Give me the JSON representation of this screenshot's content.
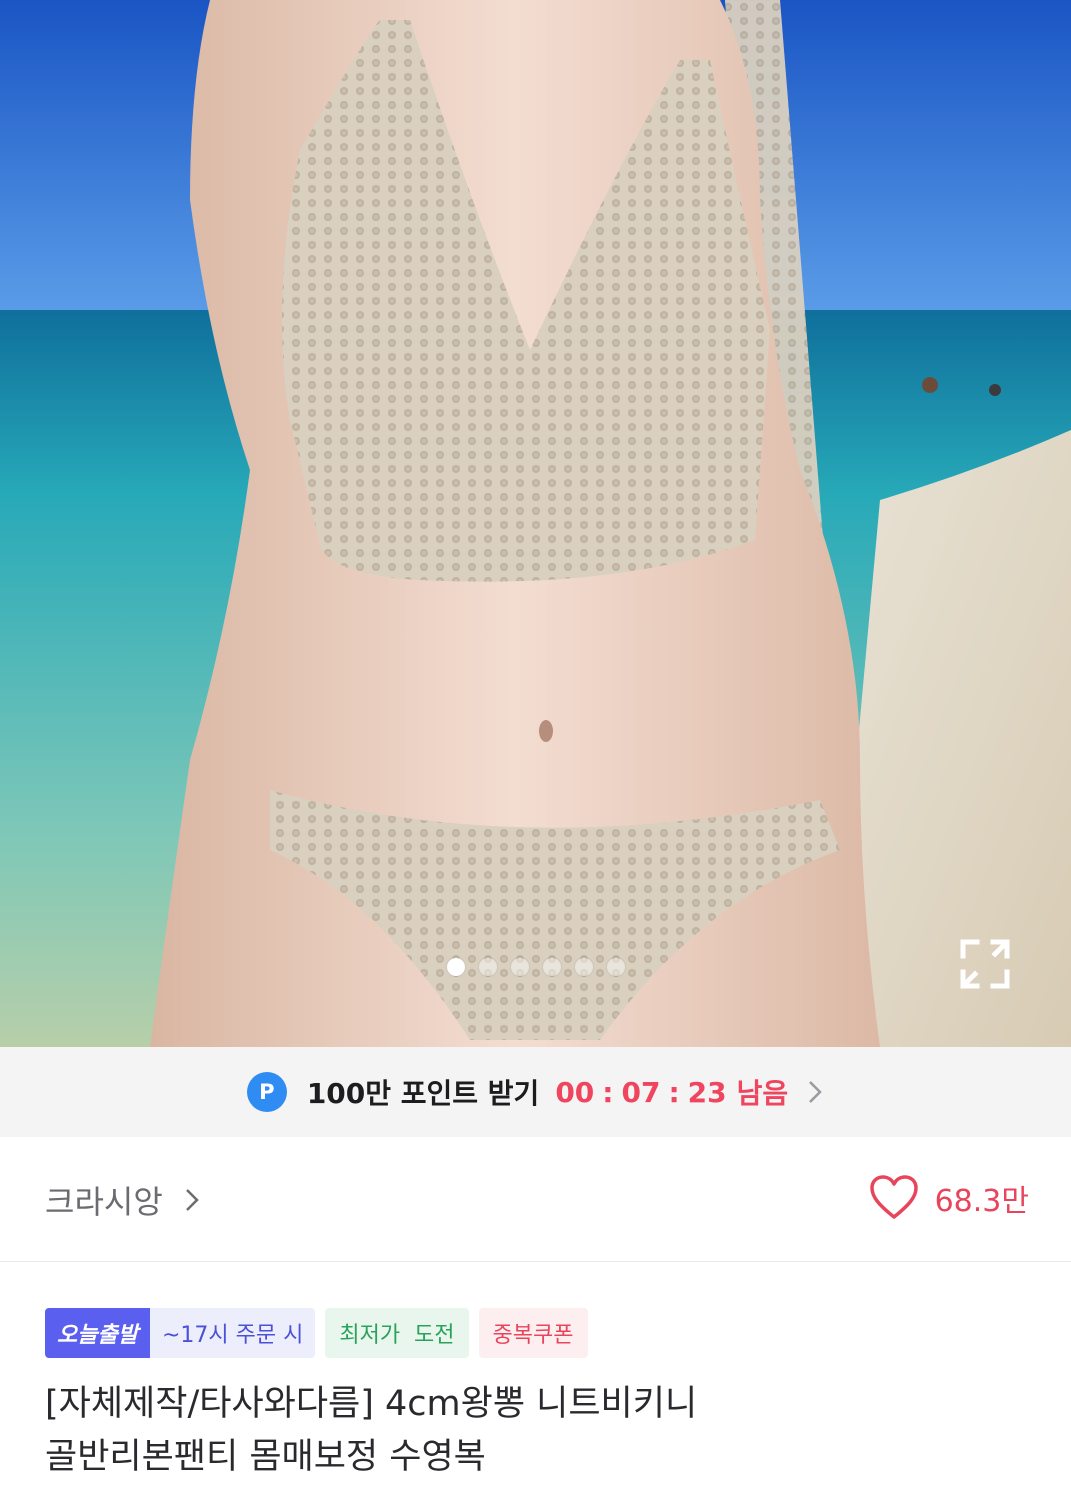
{
  "gallery": {
    "image_alt": "knit crochet bikini product photo",
    "slide_count": 6,
    "active_slide": 1,
    "expand_icon": "expand-arrows-icon"
  },
  "point_banner": {
    "badge_letter": "P",
    "label": "100만 포인트 받기",
    "hours": "00",
    "minutes": "07",
    "seconds": "23",
    "separator": ":",
    "remaining_text": "남음",
    "chevron_icon": "chevron-right-icon",
    "accent_color": "#f0455e",
    "badge_color": "#2f8cf2"
  },
  "seller": {
    "name": "크라시앙",
    "chevron_icon": "chevron-right-icon"
  },
  "likes": {
    "count": "68.3만",
    "icon": "heart-outline-icon",
    "color": "#e8455c"
  },
  "badges": {
    "today_shipping": "오늘출발",
    "today_shipping_condition": "~17시 주문 시",
    "lowest_price": "최저가  도전",
    "duplicate_coupon": "중복쿠폰"
  },
  "product": {
    "title_line1": "[자체제작/타사와다름] 4cm왕뽕 니트비키니",
    "title_line2": "골반리본팬티 몸매보정 수영복"
  }
}
